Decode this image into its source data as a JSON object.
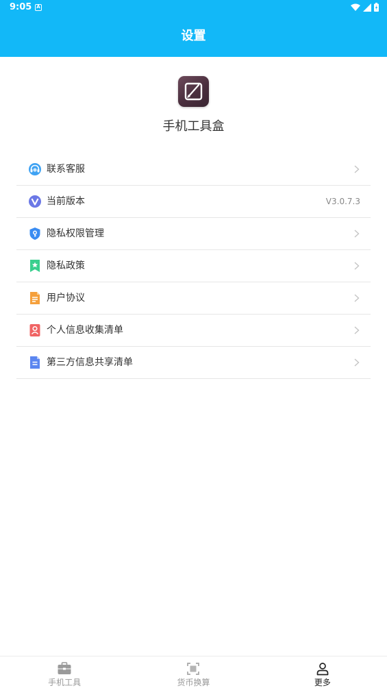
{
  "status_bar": {
    "time": "9:05",
    "notification_badge": "A"
  },
  "header": {
    "title": "设置"
  },
  "app": {
    "name": "手机工具盒",
    "logo_icon": "pencil-box-icon"
  },
  "menu": [
    {
      "label": "联系客服",
      "icon": "headset-icon",
      "icon_color": "#3ea2f3",
      "value": ""
    },
    {
      "label": "当前版本",
      "icon": "version-v-icon",
      "icon_color": "#6b78e6",
      "value": "V3.0.7.3"
    },
    {
      "label": "隐私权限管理",
      "icon": "shield-key-icon",
      "icon_color": "#3a8cf2",
      "value": ""
    },
    {
      "label": "隐私政策",
      "icon": "bookmark-star-icon",
      "icon_color": "#39cf8e",
      "value": ""
    },
    {
      "label": "用户协议",
      "icon": "document-icon",
      "icon_color": "#f5a03c",
      "value": ""
    },
    {
      "label": "个人信息收集清单",
      "icon": "user-card-icon",
      "icon_color": "#f06464",
      "value": ""
    },
    {
      "label": "第三方信息共享清单",
      "icon": "file-list-icon",
      "icon_color": "#5b86f0",
      "value": ""
    }
  ],
  "tabs": [
    {
      "label": "手机工具",
      "icon": "toolbox-icon",
      "active": false
    },
    {
      "label": "货币换算",
      "icon": "scan-frame-icon",
      "active": false
    },
    {
      "label": "更多",
      "icon": "person-icon",
      "active": true
    }
  ],
  "colors": {
    "primary": "#12b8f8",
    "divider": "#e6e6e6",
    "muted": "#999999"
  }
}
